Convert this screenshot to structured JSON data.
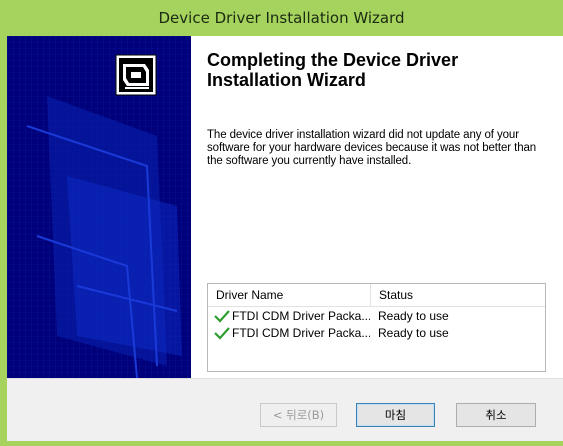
{
  "window": {
    "title": "Device Driver Installation Wizard"
  },
  "wizard": {
    "heading": "Completing the Device Driver Installation Wizard",
    "description": "The device driver installation wizard did not update any of your software for your hardware devices because it was not better than the software you currently have installed."
  },
  "drivers": {
    "headers": [
      "Driver Name",
      "Status"
    ],
    "rows": [
      {
        "name": "FTDI CDM Driver Packa...",
        "status": "Ready to use",
        "icon": "check-icon"
      },
      {
        "name": "FTDI CDM Driver Packa...",
        "status": "Ready to use",
        "icon": "check-icon"
      }
    ]
  },
  "buttons": {
    "back": "< 뒤로(B)",
    "finish": "마침",
    "cancel": "취소"
  },
  "colors": {
    "title_bar": "#a6d35e",
    "banner": "#00007a",
    "check": "#2e9e2e"
  }
}
